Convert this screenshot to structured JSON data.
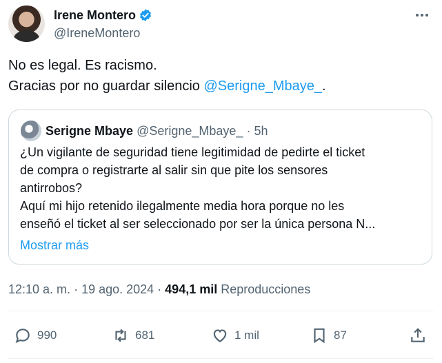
{
  "author": {
    "display_name": "Irene Montero",
    "handle": "@IreneMontero",
    "verified": true
  },
  "tweet": {
    "line1": "No es legal. Es racismo.",
    "line2_prefix": "Gracias por no guardar silencio ",
    "line2_mention": "@Serigne_Mbaye_",
    "line2_suffix": "."
  },
  "quote": {
    "display_name": "Serigne Mbaye",
    "handle": "@Serigne_Mbaye_",
    "separator": " · ",
    "time": "5h",
    "lines": [
      "¿Un vigilante de seguridad tiene legitimidad de pedirte el ticket",
      "de compra o registrarte al salir sin que pite los sensores",
      "antirrobos?",
      "Aquí mi hijo retenido ilegalmente media hora porque no les",
      "enseñó el ticket al ser seleccionado por ser la única persona N..."
    ],
    "show_more": "Mostrar más"
  },
  "meta": {
    "time": "12:10 a. m.",
    "dot1": " · ",
    "date": "19 ago. 2024",
    "dot2": " · ",
    "views_count": "494,1 mil",
    "views_label": " Reproducciones"
  },
  "actions": {
    "replies": "990",
    "reposts": "681",
    "likes": "1 mil",
    "bookmarks": "87"
  },
  "colors": {
    "accent": "#1d9bf0",
    "text": "#0f1419",
    "muted": "#536471",
    "border": "#cfd9de"
  },
  "icons": [
    "more-icon",
    "verified-badge-icon",
    "reply-icon",
    "repost-icon",
    "like-icon",
    "bookmark-icon",
    "share-icon"
  ]
}
